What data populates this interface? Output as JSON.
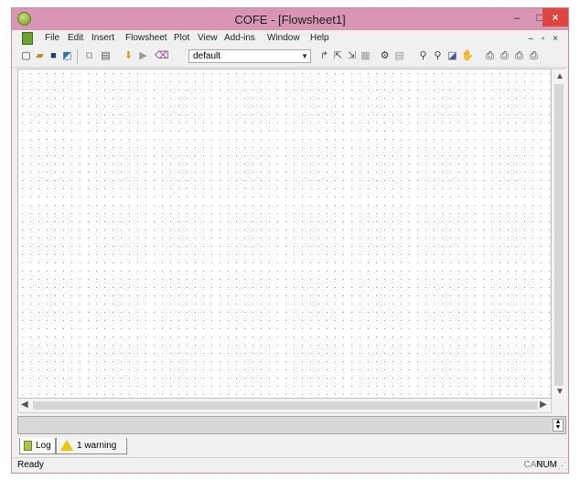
{
  "window": {
    "title": "COFE - [Flowsheet1]"
  },
  "titlebar": {
    "minimize": "–",
    "maximize": "□",
    "close": "×"
  },
  "menu": {
    "items": [
      "File",
      "Edit",
      "Insert",
      "Flowsheet",
      "Plot",
      "View",
      "Add-ins",
      "Window",
      "Help"
    ],
    "mdi_controls": "– ▫ ×"
  },
  "toolbar": {
    "combo_value": "default",
    "icons": [
      "new-icon",
      "open-icon",
      "save-icon",
      "save-as-icon",
      "copy-icon",
      "paste-icon",
      "import-icon",
      "run-icon",
      "eraser-icon",
      "stream-icon",
      "stream-split-icon",
      "stream-join-icon",
      "grid-icon",
      "settings-icon",
      "report-icon",
      "zoom-in-icon",
      "zoom-out-icon",
      "zoom-fit-icon",
      "pan-icon",
      "print-icon",
      "print-preview-icon",
      "print-setup-icon",
      "print-all-icon"
    ]
  },
  "log": {
    "tab_log": "Log",
    "tab_warning": "1 warning"
  },
  "status": {
    "text": "Ready",
    "cap": "CAP",
    "num": "NUM"
  },
  "colors": {
    "titlebar": "#d896b4",
    "close": "#e0443e"
  }
}
